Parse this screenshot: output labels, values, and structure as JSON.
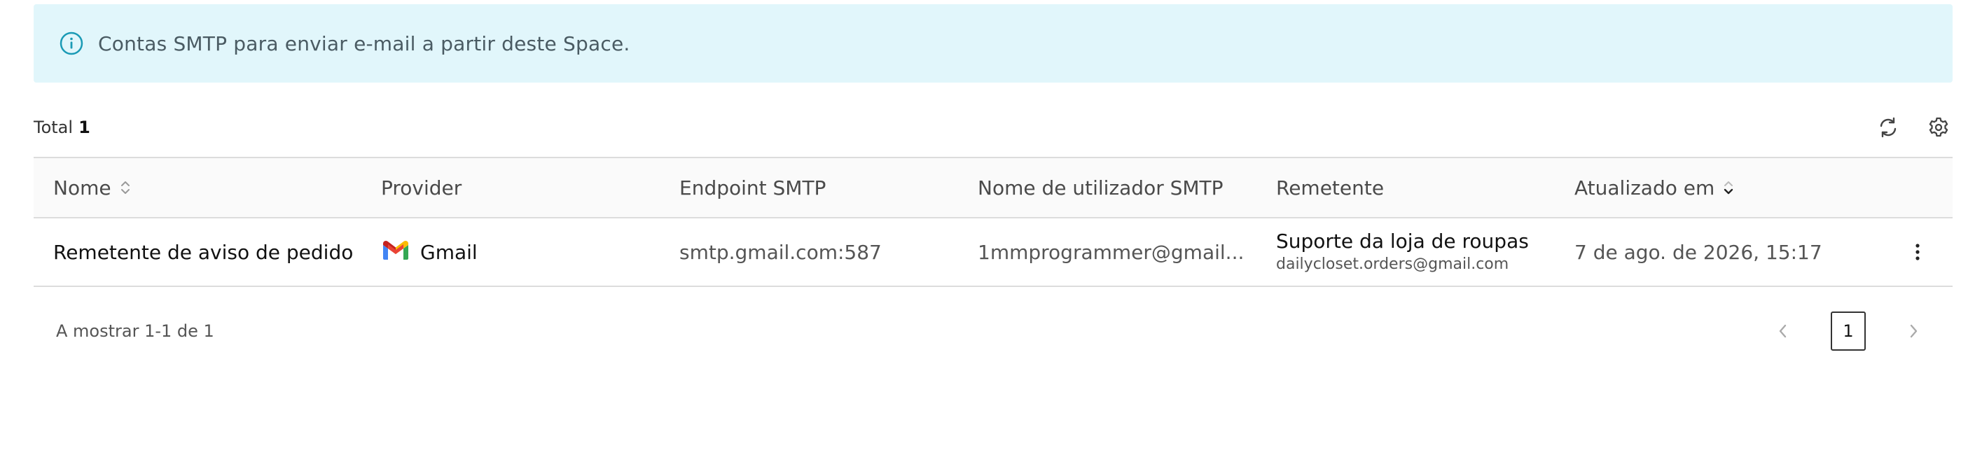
{
  "banner": {
    "icon": "info-icon",
    "text": "Contas SMTP para enviar e-mail a partir deste Space."
  },
  "summary": {
    "total_label": "Total",
    "total_count": "1"
  },
  "toolbar": {
    "icons": [
      "refresh-icon",
      "settings-icon"
    ]
  },
  "table": {
    "columns": [
      "Nome",
      "Provider",
      "Endpoint SMTP",
      "Nome de utilizador SMTP",
      "Remetente",
      "Atualizado em"
    ],
    "rows": [
      {
        "name": "Remetente de aviso de pedido",
        "provider": "Gmail",
        "provider_icon": "gmail-icon",
        "endpoint": "smtp.gmail.com:587",
        "username": "1mmprogrammer@gmail...",
        "sender_name": "Suporte da loja de roupas",
        "sender_email": "dailycloset.orders@gmail.com",
        "updated": "7 de ago. de 2026, 15:17"
      }
    ]
  },
  "pagination": {
    "showing": "A mostrar 1-1 de 1",
    "current_page": "1"
  },
  "colors": {
    "banner_bg": "#e1f6fb",
    "info_accent": "#1a9ab5",
    "border": "#dcdcdc"
  }
}
